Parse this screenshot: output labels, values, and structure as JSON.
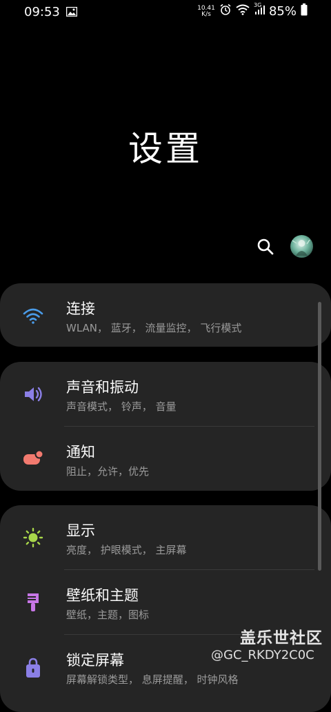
{
  "status_bar": {
    "time": "09:53",
    "net_speed_value": "10.41",
    "net_speed_unit": "K/s",
    "signal_type": "3G",
    "battery": "85%"
  },
  "page": {
    "title": "设置"
  },
  "header_actions": {
    "search_icon": "search-icon",
    "avatar": "profile-avatar"
  },
  "groups": [
    {
      "items": [
        {
          "title": "连接",
          "subtitle": "WLAN， 蓝牙， 流量监控， 飞行模式",
          "icon": "wifi-icon",
          "icon_color": "#4a9be8"
        }
      ]
    },
    {
      "items": [
        {
          "title": "声音和振动",
          "subtitle": "声音模式， 铃声， 音量",
          "icon": "volume-icon",
          "icon_color": "#8b7fe6"
        },
        {
          "title": "通知",
          "subtitle": "阻止，允许，优先",
          "icon": "notification-icon",
          "icon_color": "#f27a6f"
        }
      ]
    },
    {
      "items": [
        {
          "title": "显示",
          "subtitle": "亮度， 护眼模式， 主屏幕",
          "icon": "brightness-icon",
          "icon_color": "#a8d74a"
        },
        {
          "title": "壁纸和主题",
          "subtitle": "壁纸，主题，图标",
          "icon": "paintbrush-icon",
          "icon_color": "#c776e6"
        },
        {
          "title": "锁定屏幕",
          "subtitle": "屏幕解锁类型， 息屏提醒， 时钟风格",
          "icon": "lock-icon",
          "icon_color": "#8b7fe6"
        }
      ]
    }
  ],
  "watermark": {
    "title": "盖乐世社区",
    "user": "@GC_RKDY2C0C"
  }
}
